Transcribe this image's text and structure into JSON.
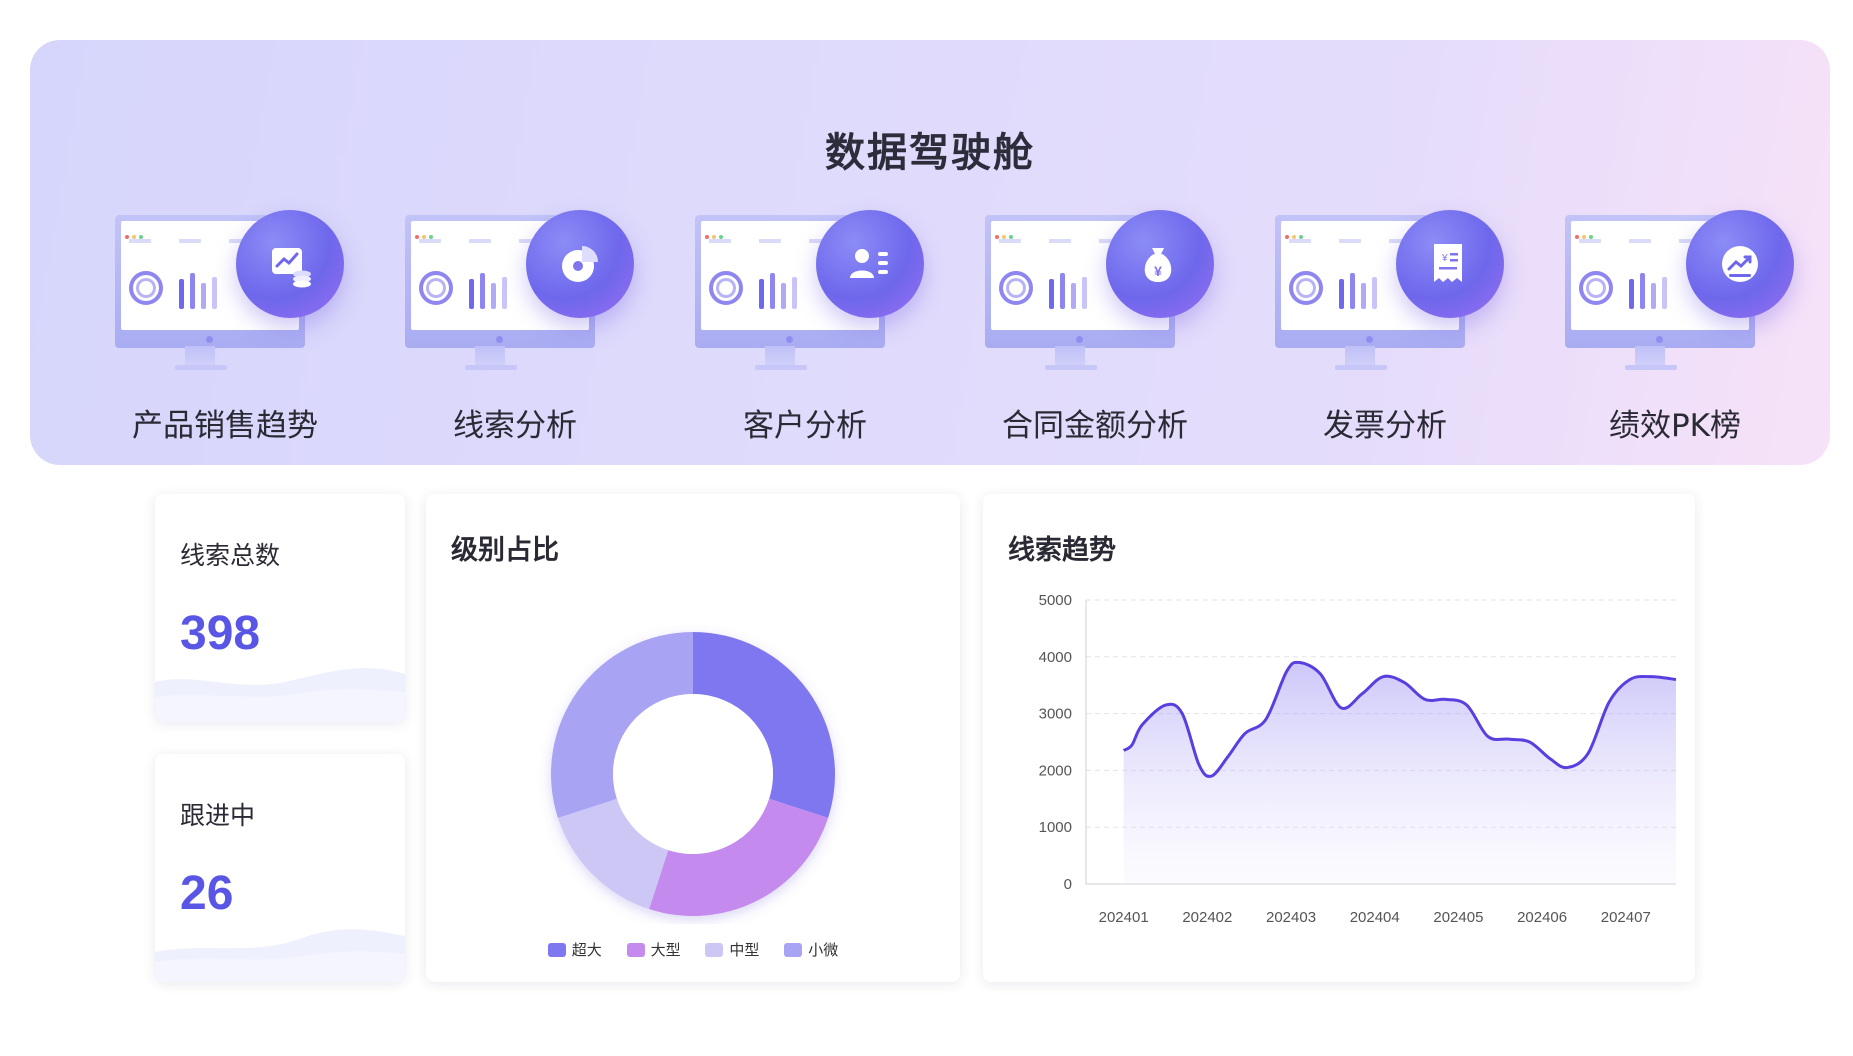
{
  "hero": {
    "title": "数据驾驶舱",
    "modules": [
      {
        "label": "产品销售趋势",
        "icon": "trend-chart-icon"
      },
      {
        "label": "线索分析",
        "icon": "pie-chart-icon"
      },
      {
        "label": "客户分析",
        "icon": "customer-card-icon"
      },
      {
        "label": "合同金额分析",
        "icon": "money-bag-icon"
      },
      {
        "label": "发票分析",
        "icon": "invoice-icon"
      },
      {
        "label": "绩效PK榜",
        "icon": "performance-trend-icon"
      }
    ]
  },
  "stats": [
    {
      "title": "线索总数",
      "value": "398"
    },
    {
      "title": "跟进中",
      "value": "26"
    }
  ],
  "level_chart": {
    "title": "级别占比",
    "legend": [
      "超大",
      "大型",
      "中型",
      "小微"
    ]
  },
  "trend_chart": {
    "title": "线索趋势"
  },
  "chart_data": [
    {
      "type": "pie",
      "title": "级别占比",
      "labels": [
        "超大",
        "大型",
        "中型",
        "小微"
      ],
      "values": [
        30,
        25,
        15,
        30
      ],
      "colors": [
        "#7e77f0",
        "#c58aee",
        "#cdc7f6",
        "#a8a3f2"
      ],
      "legend": "bottom"
    },
    {
      "type": "area",
      "title": "线索趋势",
      "xlabel": "",
      "ylabel": "",
      "ylim": [
        0,
        5000
      ],
      "yticks": [
        0,
        1000,
        2000,
        3000,
        4000,
        5000
      ],
      "categories": [
        "202401",
        "202402",
        "202403",
        "202404",
        "202405",
        "202406",
        "202407"
      ],
      "x": [
        0,
        0.1,
        0.22,
        0.5,
        0.7,
        0.9,
        1.05,
        1.25,
        1.45,
        1.7,
        1.95,
        2.1,
        2.35,
        2.6,
        2.85,
        3.1,
        3.35,
        3.6,
        3.85,
        4.1,
        4.35,
        4.6,
        4.85,
        5.1,
        5.3,
        5.55,
        5.8,
        6.05,
        6.3,
        6.6
      ],
      "values": [
        2350,
        2450,
        2800,
        3150,
        3000,
        2100,
        1900,
        2250,
        2650,
        2900,
        3750,
        3900,
        3700,
        3100,
        3350,
        3650,
        3550,
        3250,
        3250,
        3150,
        2600,
        2550,
        2500,
        2200,
        2050,
        2300,
        3200,
        3600,
        3650,
        3600
      ],
      "color": "#5a3fe0",
      "grid": true,
      "grid_style": "dashed horizontal"
    }
  ]
}
